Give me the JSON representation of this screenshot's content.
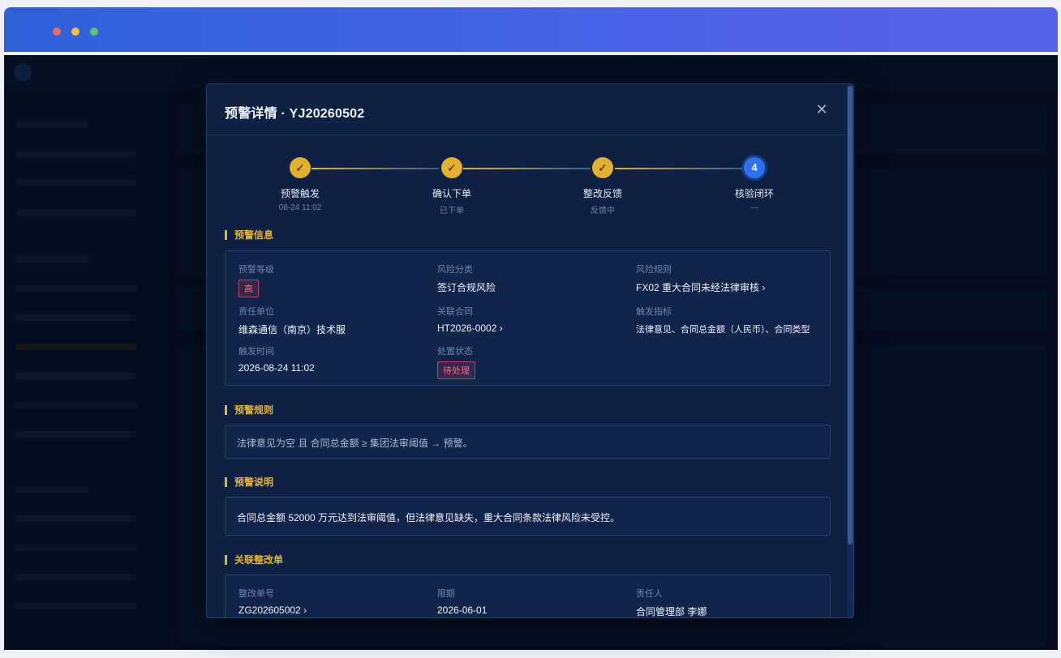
{
  "modal": {
    "title": "预警详情 · YJ20260502",
    "close_icon": "close-icon"
  },
  "steps": [
    {
      "label": "预警触发",
      "sub": "08-24 11:02",
      "icon": "✓",
      "state": "done"
    },
    {
      "label": "确认下单",
      "sub": "已下单",
      "icon": "✓",
      "state": "done"
    },
    {
      "label": "整改反馈",
      "sub": "反馈中",
      "icon": "✓",
      "state": "done"
    },
    {
      "label": "核验闭环",
      "sub": "—",
      "icon": "4",
      "state": "active"
    }
  ],
  "alert_info": {
    "section_title": "预警信息",
    "level_label": "预警等级",
    "level_value": "高",
    "category_label": "风险分类",
    "category_value": "签订合规风险",
    "rule_label": "风险规则",
    "rule_value": "FX02 重大合同未经法律审核 ›",
    "unit_label": "责任单位",
    "unit_value": "维森通信（南京）技术服",
    "contract_label": "关联合同",
    "contract_value": "HT2026-0002 ›",
    "indicator_label": "触发指标",
    "indicator_value": "法律意见、合同总金额（人民币）、合同类型",
    "time_label": "触发时间",
    "time_value": "2026-08-24 11:02",
    "status_label": "处置状态",
    "status_value": "待处理"
  },
  "alert_rule": {
    "section_title": "预警规则",
    "text": "法律意见为空 且 合同总金额 ≥ 集团法审阈值 → 预警。"
  },
  "alert_desc": {
    "section_title": "预警说明",
    "text": "合同总金额 52000 万元达到法审阈值，但法律意见缺失，重大合同条款法律风险未受控。"
  },
  "rectification": {
    "section_title": "关联整改单",
    "no_label": "整改单号",
    "no_value": "ZG202605002 ›",
    "deadline_label": "限期",
    "deadline_value": "2026-06-01",
    "owner_label": "责任人",
    "owner_value": "合同管理部 李娜"
  },
  "colors": {
    "accent_gold": "#e3b12e",
    "active_blue": "#2f6ff5",
    "danger_red": "#ff6b7a"
  }
}
